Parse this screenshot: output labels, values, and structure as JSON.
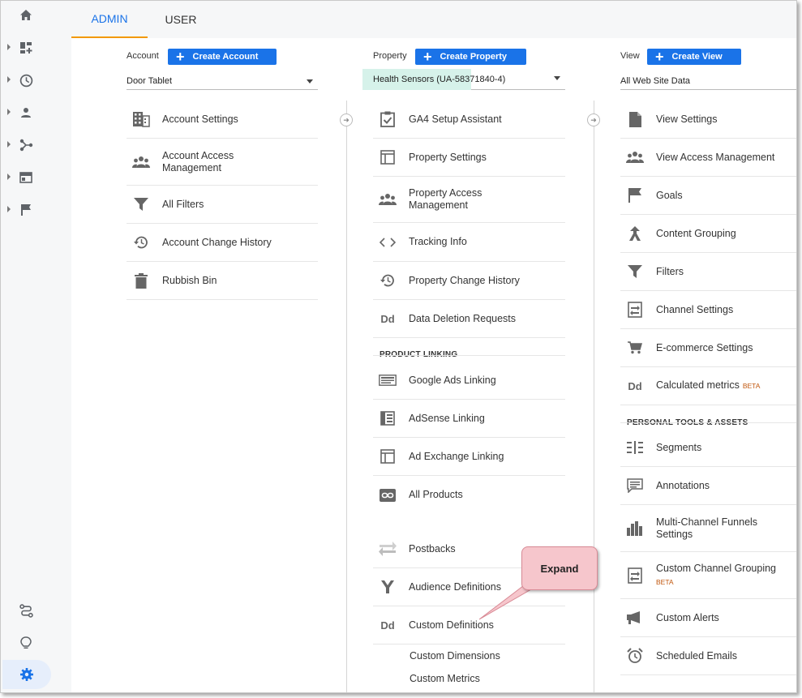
{
  "tabs": [
    {
      "label": "ADMIN",
      "active": true
    },
    {
      "label": "USER",
      "active": false
    }
  ],
  "colors": {
    "accent": "#1a73e8",
    "tab_underline": "#f29900",
    "beta": "#c1570e",
    "highlight": "#d6f2ea",
    "callout_bg": "#f6c6cc"
  },
  "left_nav": {
    "top_icons": [
      "home-icon",
      "customization-icon",
      "realtime-icon",
      "audience-icon",
      "acquisition-icon",
      "behavior-icon",
      "conversions-icon"
    ],
    "bottom_icons": [
      "attribution-icon",
      "discover-icon",
      "admin-icon"
    ]
  },
  "account": {
    "label": "Account",
    "create_label": "Create Account",
    "selected": "Door Tablet",
    "items": [
      {
        "label": "Account Settings",
        "icon": "building-icon"
      },
      {
        "label": "Account Access Management",
        "icon": "people-icon"
      },
      {
        "label": "All Filters",
        "icon": "filter-icon"
      },
      {
        "label": "Account Change History",
        "icon": "history-icon"
      },
      {
        "label": "Rubbish Bin",
        "icon": "trash-icon"
      }
    ]
  },
  "property": {
    "label": "Property",
    "create_label": "Create Property",
    "selected": "Health Sensors (UA-58371840-4)",
    "items": [
      {
        "label": "GA4 Setup Assistant",
        "icon": "checklist-icon"
      },
      {
        "label": "Property Settings",
        "icon": "layout-icon"
      },
      {
        "label": "Property Access Management",
        "icon": "people-icon"
      },
      {
        "label": "Tracking Info",
        "icon": "code-icon"
      },
      {
        "label": "Property Change History",
        "icon": "history-icon"
      },
      {
        "label": "Data Deletion Requests",
        "icon": "dd-icon"
      }
    ],
    "linking_head": "PRODUCT LINKING",
    "linking_items": [
      {
        "label": "Google Ads Linking",
        "icon": "ads-icon"
      },
      {
        "label": "AdSense Linking",
        "icon": "adsense-icon"
      },
      {
        "label": "Ad Exchange Linking",
        "icon": "layout-icon"
      },
      {
        "label": "All Products",
        "icon": "link-icon"
      }
    ],
    "more_items": [
      {
        "label": "Postbacks",
        "icon": "postbacks-icon"
      },
      {
        "label": "Audience Definitions",
        "icon": "fork-icon"
      },
      {
        "label": "Custom Definitions",
        "icon": "dd-icon"
      }
    ],
    "sub_items": [
      "Custom Dimensions",
      "Custom Metrics"
    ]
  },
  "view": {
    "label": "View",
    "create_label": "Create View",
    "selected": "All Web Site Data",
    "items": [
      {
        "label": "View Settings",
        "icon": "document-icon"
      },
      {
        "label": "View Access Management",
        "icon": "people-icon"
      },
      {
        "label": "Goals",
        "icon": "flag-icon"
      },
      {
        "label": "Content Grouping",
        "icon": "grouping-icon"
      },
      {
        "label": "Filters",
        "icon": "filter-icon"
      },
      {
        "label": "Channel Settings",
        "icon": "channel-icon"
      },
      {
        "label": "E-commerce Settings",
        "icon": "cart-icon"
      },
      {
        "label": "Calculated metrics",
        "icon": "dd-icon",
        "badge": "BETA"
      }
    ],
    "tools_head": "PERSONAL TOOLS & ASSETS",
    "tools_items": [
      {
        "label": "Segments",
        "icon": "segments-icon"
      },
      {
        "label": "Annotations",
        "icon": "comment-icon"
      },
      {
        "label": "Multi-Channel Funnels Settings",
        "icon": "bars-icon"
      },
      {
        "label": "Custom Channel Grouping",
        "icon": "channel-icon",
        "badge": "BETA"
      },
      {
        "label": "Custom Alerts",
        "icon": "megaphone-icon"
      },
      {
        "label": "Scheduled Emails",
        "icon": "alarm-icon"
      }
    ]
  },
  "callout": {
    "text": "Expand"
  }
}
